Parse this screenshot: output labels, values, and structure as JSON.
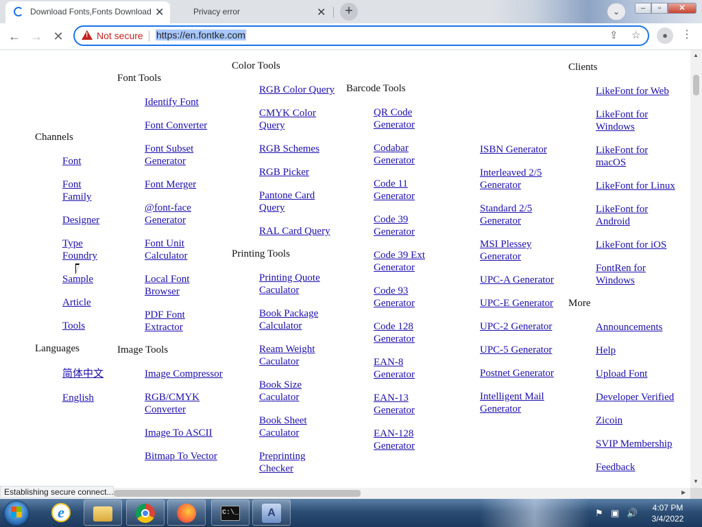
{
  "browser": {
    "tabs": [
      {
        "title": "Download Fonts,Fonts Download",
        "state": "loading"
      },
      {
        "title": "Privacy error"
      }
    ],
    "new_tab_icon": "plus-icon",
    "address": {
      "security_label": "Not secure",
      "url": "https://en.fontke.com"
    }
  },
  "page": {
    "channels": {
      "heading": "Channels",
      "items": [
        "Font",
        "Font Family",
        "Designer",
        "Type Foundry",
        "Sample",
        "Article",
        "Tools"
      ]
    },
    "languages": {
      "heading": "Languages",
      "items": [
        "简体中文",
        "English"
      ]
    },
    "font_tools": {
      "heading": "Font Tools",
      "items": [
        "Identify Font",
        "Font Converter",
        "Font Subset Generator",
        "Font Merger",
        "@font-face Generator",
        "Font Unit Calculator",
        "Local Font Browser",
        "PDF Font Extractor"
      ]
    },
    "image_tools": {
      "heading": "Image Tools",
      "items": [
        "Image Compressor",
        "RGB/CMYK Converter",
        "Image To ASCII",
        "Bitmap To Vector"
      ]
    },
    "color_tools": {
      "heading": "Color Tools",
      "items": [
        "RGB Color Query",
        "CMYK Color Query",
        "RGB Schemes",
        "RGB Picker",
        "Pantone Card Query",
        "RAL Card Query"
      ]
    },
    "printing_tools": {
      "heading": "Printing Tools",
      "items": [
        "Printing Quote Caculator",
        "Book Package Calculator",
        "Ream Weight Caculator",
        "Book Size Caculator",
        "Book Sheet Caculator",
        "Preprinting Checker"
      ]
    },
    "barcode_tools": {
      "heading": "Barcode Tools",
      "items": [
        "QR Code Generator",
        "Codabar Generator",
        "Code 11 Generator",
        "Code 39 Generator",
        "Code 39 Ext Generator",
        "Code 93 Generator",
        "Code 128 Generator",
        "EAN-8 Generator",
        "EAN-13 Generator",
        "EAN-128 Generator"
      ],
      "items_col2": [
        "ISBN Generator",
        "Interleaved 2/5 Generator",
        "Standard 2/5 Generator",
        "MSI Plessey Generator",
        "UPC-A Generator",
        "UPC-E Generator",
        "UPC-2 Generator",
        "UPC-5 Generator",
        "Postnet Generator",
        "Intelligent Mail Generator"
      ]
    },
    "clients": {
      "heading": "Clients",
      "items": [
        "LikeFont for Web",
        "LikeFont for Windows",
        "LikeFont for macOS",
        "LikeFont for Linux",
        "LikeFont for Android",
        "LikeFont for iOS",
        "FontRen for Windows"
      ]
    },
    "more": {
      "heading": "More",
      "items": [
        "Announcements",
        "Help",
        "Upload Font",
        "Developer Verified",
        "Zicoin",
        "SVIP Membership",
        "Feedback"
      ]
    }
  },
  "status_bar": "Establishing secure connect...",
  "taskbar": {
    "apps": [
      "ie-icon",
      "folder-icon",
      "chrome-icon",
      "firefox-icon",
      "cmd-icon",
      "app-icon"
    ],
    "clock": {
      "time": "4:07 PM",
      "date": "3/4/2022"
    }
  }
}
